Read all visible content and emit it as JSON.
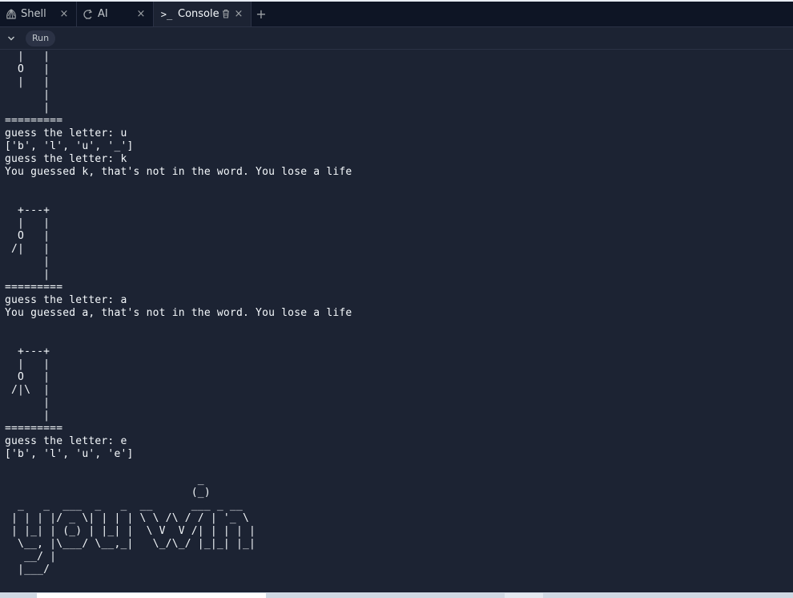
{
  "tabs": [
    {
      "label": "Shell",
      "icon": "shell-icon",
      "close": "×"
    },
    {
      "label": "AI",
      "icon": "ai-icon",
      "close": "×"
    },
    {
      "label": "Console",
      "icon_text": ">_",
      "icon": "console-icon",
      "close": "×"
    }
  ],
  "add_tab": "+",
  "toolbar": {
    "run_label": "Run"
  },
  "console": {
    "lines": [
      "  |   |",
      "  O   |",
      "  |   |",
      "      |",
      "      |",
      "=========",
      "guess the letter: u",
      "['b', 'l', 'u', '_']",
      "guess the letter: k",
      "You guessed k, that's not in the word. You lose a life",
      "",
      "",
      "  +---+",
      "  |   |",
      "  O   |",
      " /|   |",
      "      |",
      "      |",
      "=========",
      "guess the letter: a",
      "You guessed a, that's not in the word. You lose a life",
      "",
      "",
      "  +---+",
      "  |   |",
      "  O   |",
      " /|\\  |",
      "      |",
      "      |",
      "=========",
      "guess the letter: e",
      "['b', 'l', 'u', 'e']",
      "",
      "                              _",
      "                             (_)",
      "  _   _  ___  _   _  __      ___ _ __",
      " | | | |/ _ \\| | | | \\ \\ /\\ / / | '_ \\",
      " | |_| | (_) | |_| |  \\ V  V /| | | | |",
      "  \\__, |\\___/ \\__,_|   \\_/\\_/ |_|_| |_|",
      "   __/ |",
      "  |___/"
    ]
  },
  "colors": {
    "tabbar_bg": "#0e1525",
    "panel_bg": "#1c2333",
    "text": "#f5f9fc",
    "muted": "#c2c8cc"
  }
}
